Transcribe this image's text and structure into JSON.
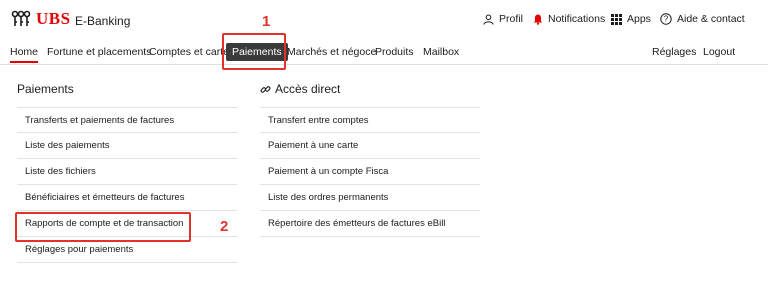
{
  "header": {
    "brand": "UBS",
    "app_name": "E-Banking",
    "utilities": [
      {
        "label": "Profil",
        "icon": "person-icon"
      },
      {
        "label": "Notifications",
        "icon": "bell-icon"
      },
      {
        "label": "Apps",
        "icon": "apps-grid-icon"
      },
      {
        "label": "Aide & contact",
        "icon": "help-icon"
      }
    ]
  },
  "nav": {
    "items": [
      "Home",
      "Fortune et placements",
      "Comptes et cartes",
      "Paiements",
      "Marchés et négoce",
      "Produits",
      "Mailbox"
    ],
    "active": "Home",
    "selected": "Paiements",
    "right": [
      "Réglages",
      "Logout"
    ]
  },
  "annotations": {
    "step1": "1",
    "step2": "2"
  },
  "paiements": {
    "title": "Paiements",
    "items": [
      "Transferts et paiements de factures",
      "Liste des paiements",
      "Liste des fichiers",
      "Bénéficiaires et émetteurs de factures",
      "Rapports de compte et de transaction",
      "Réglages pour paiements"
    ]
  },
  "acces": {
    "title": "Accès direct",
    "items": [
      "Transfert entre comptes",
      "Paiement à une carte",
      "Paiement à un compte Fisca",
      "Liste des ordres permanents",
      "Répertoire des émetteurs de factures eBill"
    ]
  },
  "colors": {
    "brand_red": "#e60000",
    "annotation_red": "#e0332b",
    "selected_bg": "#3b3b3b"
  }
}
